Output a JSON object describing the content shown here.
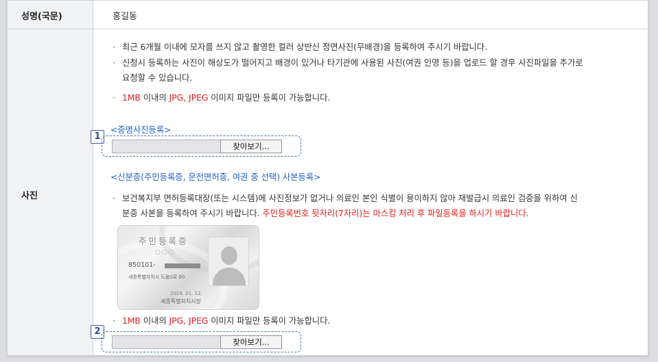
{
  "name_row": {
    "label": "성명(국문)",
    "value": "홍길동"
  },
  "photo_row": {
    "label": "사진",
    "bullet": "·",
    "notes": [
      "최근 6개월 이내에 모자를 쓰지 않고 촬영한 컬러 상반신 정면사진(무배경)을 등록하여 주시기 바랍니다.",
      "신청시 등록하는 사진이 해상도가 떨어지고 배경이 있거나 타기관에 사용된 사진(여권 인영 등)을 업로드 할 경우 사진파일을 추가로",
      "요청할 수 있습니다."
    ],
    "format_note": {
      "size": "1MB",
      "text1": " 이내의 ",
      "formats": "JPG, JPEG",
      "text2": " 이미지 파일만 등록이 가능합니다."
    },
    "photo_upload": {
      "title": "<증명사진등록>",
      "badge": "1",
      "browse_label": "찾아보기..."
    },
    "id_upload": {
      "title": "<신분증(주민등록증, 운전면허증, 여권 중 선택) 사본등록>",
      "note_line1": "보건복지부 면허등록대장(또는 시스템)에 사진정보가 없거나 의료인 본인 식별이 용이하지 않아 재발급시 의료인 검증을 위하여 신",
      "note_line2_plain": "분증 사본을 등록하여 주시기 바랍니다. ",
      "note_line2_red": "주민등록번호 뒷자리(7자리)는 마스킹 처리 후 파일등록을 하시기 바랍니다.",
      "badge": "2",
      "browse_label": "찾아보기..."
    },
    "id_card": {
      "title": "주민등록증",
      "circles": "○○○",
      "number": "850101-",
      "address": "세종특별자치시 도움0로 00",
      "date": "2019. 01. 12.",
      "issuer": "세종특별자치시장"
    }
  }
}
